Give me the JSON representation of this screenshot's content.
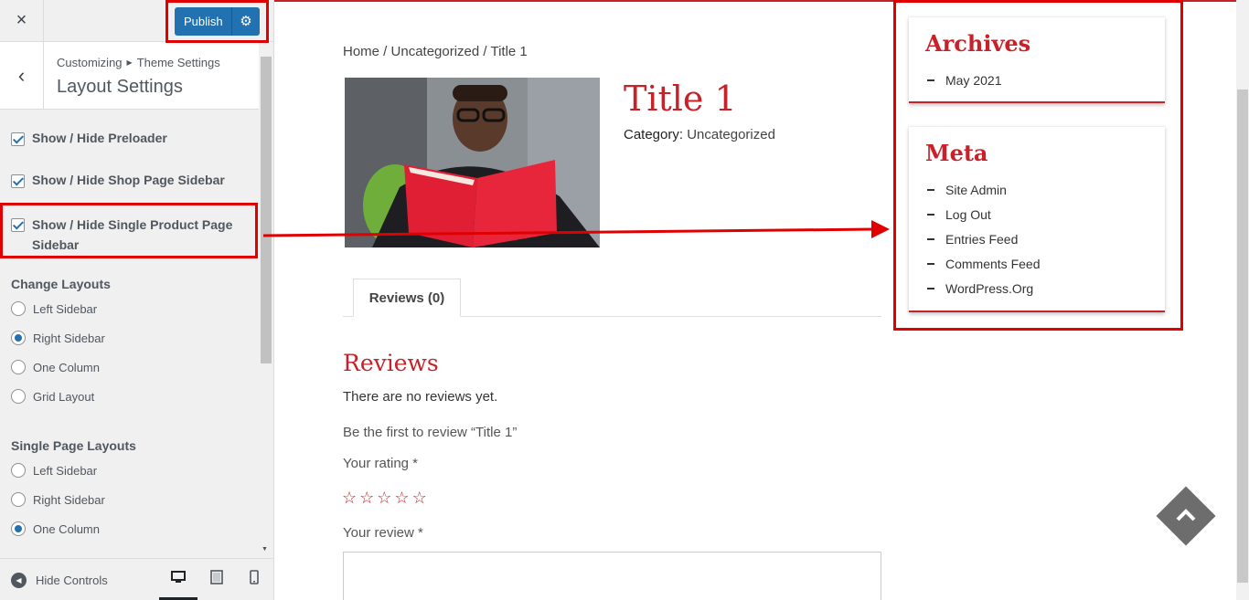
{
  "customizer": {
    "close_icon": "×",
    "publish_label": "Publish",
    "back_icon": "‹",
    "breadcrumb": {
      "root": "Customizing",
      "parent": "Theme Settings"
    },
    "section_title": "Layout Settings",
    "checkboxes": [
      {
        "label": "Show / Hide Preloader",
        "checked": true
      },
      {
        "label": "Show / Hide Shop Page Sidebar",
        "checked": true
      },
      {
        "label": "Show / Hide Single Product Page Sidebar",
        "checked": true
      }
    ],
    "change_layouts": {
      "title": "Change Layouts",
      "options": [
        "Left Sidebar",
        "Right Sidebar",
        "One Column",
        "Grid Layout"
      ],
      "selected": "Right Sidebar"
    },
    "single_page_layouts": {
      "title": "Single Page Layouts",
      "options": [
        "Left Sidebar",
        "Right Sidebar",
        "One Column"
      ],
      "selected": "One Column"
    },
    "footer": {
      "hide_controls_label": "Hide Controls",
      "devices": [
        "desktop",
        "tablet",
        "mobile"
      ],
      "active_device": "desktop"
    }
  },
  "preview": {
    "breadcrumb": "Home / Uncategorized / Title 1",
    "product_title": "Title 1",
    "category_label": "Category:",
    "category_value": "Uncategorized",
    "tab_label": "Reviews (0)",
    "reviews_title": "Reviews",
    "no_reviews": "There are no reviews yet.",
    "first_review": "Be the first to review “Title 1”",
    "rating_label": "Your rating *",
    "rating_stars": 5,
    "review_label": "Your review *",
    "archives": {
      "title": "Archives",
      "items": [
        "May 2021"
      ]
    },
    "meta": {
      "title": "Meta",
      "items": [
        "Site Admin",
        "Log Out",
        "Entries Feed",
        "Comments Feed",
        "WordPress.Org"
      ]
    }
  },
  "colors": {
    "accent_red": "#c7222a",
    "publish_blue": "#2271b1",
    "annotation_red": "#e00000"
  }
}
